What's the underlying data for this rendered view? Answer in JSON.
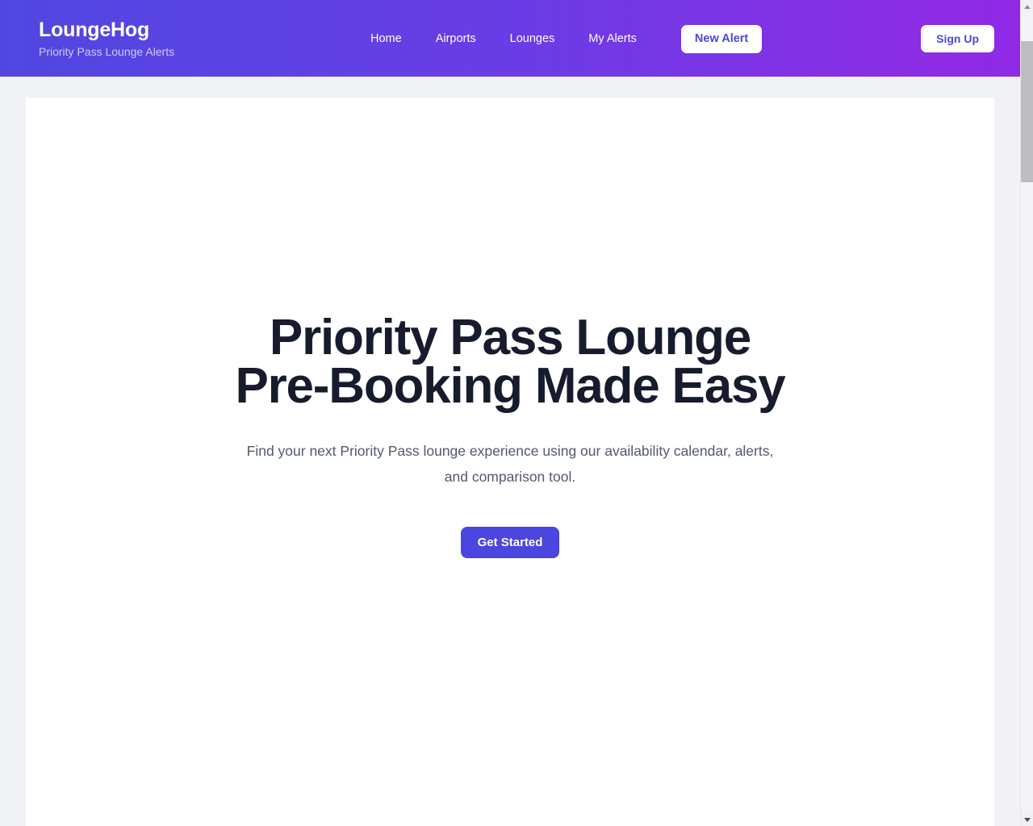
{
  "header": {
    "brand_name": "LoungeHog",
    "brand_tagline": "Priority Pass Lounge Alerts",
    "nav": [
      {
        "label": "Home"
      },
      {
        "label": "Airports"
      },
      {
        "label": "Lounges"
      },
      {
        "label": "My Alerts"
      }
    ],
    "new_alert_label": "New Alert",
    "sign_up_label": "Sign Up",
    "gradient_start": "#5147e0",
    "gradient_end": "#9029e6",
    "text_color": "#ffffff",
    "tagline_color": "#cfcaf2"
  },
  "hero": {
    "title_line_1": "Priority Pass Lounge",
    "title_line_2": "Pre-Booking Made Easy",
    "subtitle": "Find your next Priority Pass lounge experience using our availability calendar, alerts, and comparison tool.",
    "cta_label": "Get Started",
    "title_color": "#161c2d",
    "subtitle_color": "#51596b",
    "cta_color": "#4c46e0"
  },
  "page": {
    "background_color": "#f1f2f6",
    "card_background": "#ffffff"
  },
  "scrollbar": {
    "up_icon": "chevron-up-icon",
    "down_icon": "chevron-down-icon",
    "thumb_color": "#bdbdc1",
    "track_color": "#f4f4f6"
  }
}
